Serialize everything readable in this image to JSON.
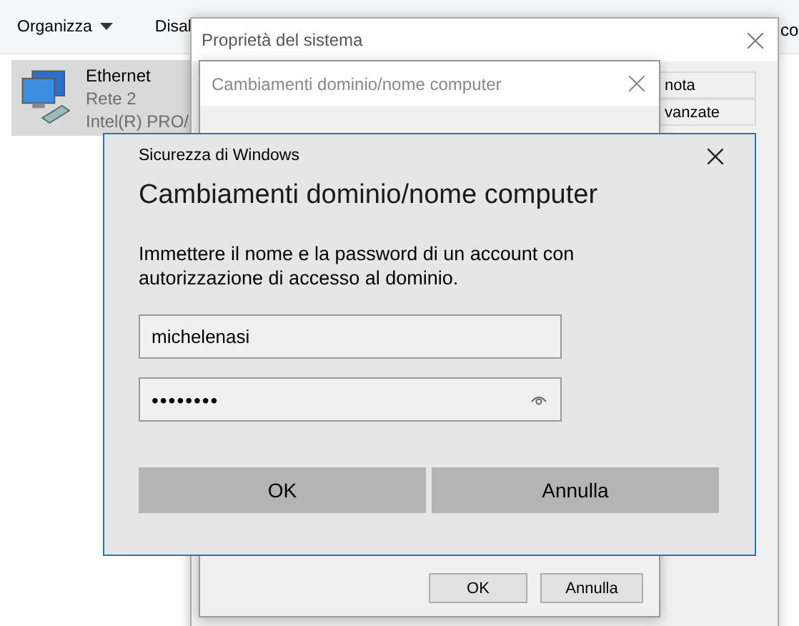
{
  "explorer": {
    "toolbar": [
      {
        "label": "Organizza",
        "dropdown": true
      },
      {
        "label": "Disal",
        "dropdown": false
      }
    ],
    "right_text": "co",
    "item": {
      "name": "Ethernet",
      "network": "Rete 2",
      "adapter": "Intel(R) PRO/",
      "selected": true
    }
  },
  "system_properties": {
    "title": "Proprietà del sistema",
    "tabs": [
      {
        "label": "nota"
      },
      {
        "label": "vanzate"
      }
    ],
    "dialog": {
      "title": "Cambiamenti dominio/nome computer",
      "buttons": [
        "OK",
        "Annulla"
      ]
    }
  },
  "security": {
    "caption": "Sicurezza di Windows",
    "heading": "Cambiamenti dominio/nome computer",
    "message": "Immettere il nome e la password di un account con autorizzazione di accesso al dominio.",
    "username": "michelenasi",
    "password": "••••••••",
    "buttons": [
      "OK",
      "Annulla"
    ]
  }
}
